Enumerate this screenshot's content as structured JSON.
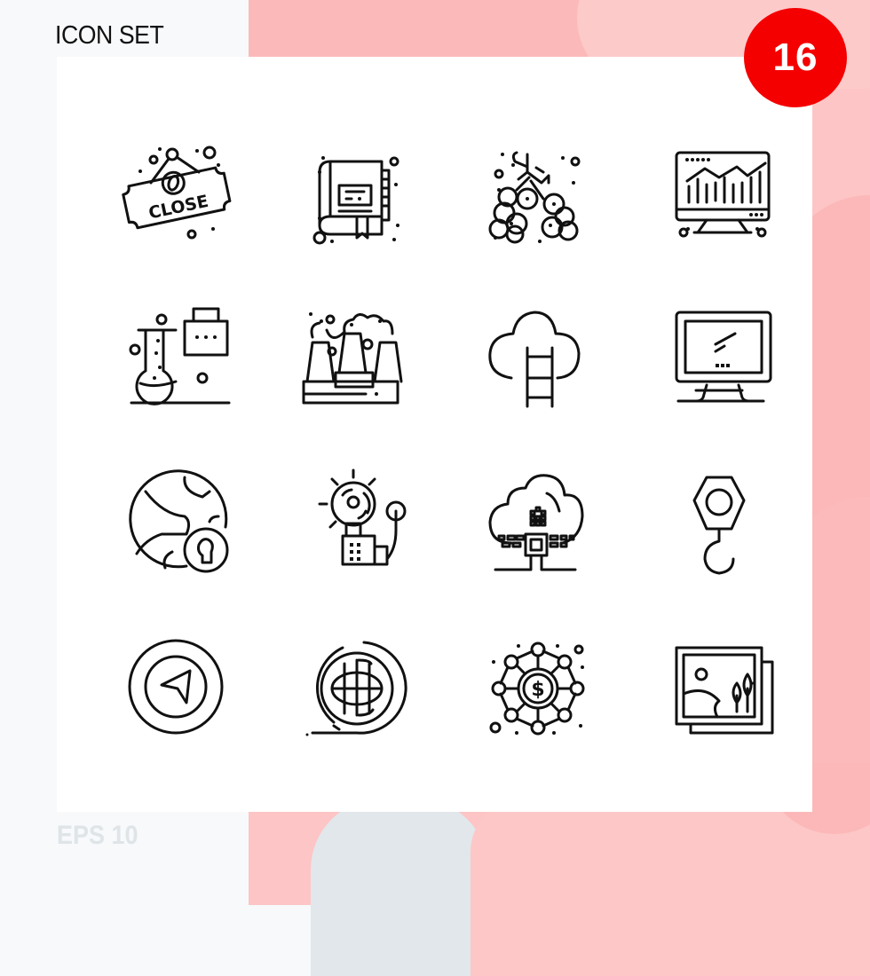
{
  "header": {
    "title": "ICON SET"
  },
  "badge": {
    "count": "16",
    "color": "#f40000"
  },
  "footer": {
    "format_label": "EPS 10"
  },
  "icons": [
    {
      "name": "close-sign-icon",
      "text": "CLOSE"
    },
    {
      "name": "book-icon"
    },
    {
      "name": "berries-icon"
    },
    {
      "name": "monitor-analytics-icon"
    },
    {
      "name": "lab-flask-icon"
    },
    {
      "name": "factory-pollution-icon"
    },
    {
      "name": "cloud-ladder-icon"
    },
    {
      "name": "computer-monitor-icon"
    },
    {
      "name": "globe-lock-icon"
    },
    {
      "name": "alarm-bell-icon"
    },
    {
      "name": "cloud-network-icon"
    },
    {
      "name": "crane-hook-icon"
    },
    {
      "name": "navigation-arrow-icon"
    },
    {
      "name": "world-globe-icon"
    },
    {
      "name": "dollar-network-icon"
    },
    {
      "name": "picture-gallery-icon"
    }
  ]
}
